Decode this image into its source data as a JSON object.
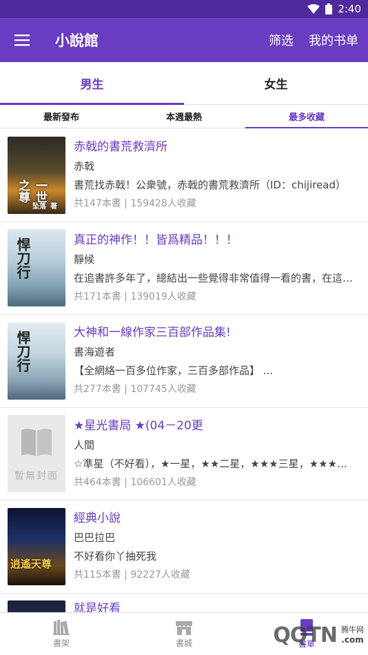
{
  "status_bar": {
    "time": "2:40"
  },
  "app_bar": {
    "title": "小說館",
    "filter_label": "筛选",
    "booklist_label": "我的书单"
  },
  "gender_tabs": [
    {
      "label": "男生",
      "active": true
    },
    {
      "label": "女生",
      "active": false
    }
  ],
  "sort_tabs": [
    {
      "label": "最新發布",
      "active": false
    },
    {
      "label": "本週最熱",
      "active": false
    },
    {
      "label": "最多收藏",
      "active": true
    }
  ],
  "booklists": [
    {
      "title": "赤戟的書荒救濟所",
      "author": "赤戟",
      "desc": "書荒找赤戟！公衆號，赤戟的書荒救濟所（ID：chijiread）",
      "stats": "共147本書 | 159428人收藏",
      "cover_text": "一世之尊",
      "cover_author": "坠落",
      "cover_author_mark": "著"
    },
    {
      "title": "真正的神作！！皆爲精品！！！",
      "author": "靜候",
      "desc": "在追書許多年了，總結出一些覺得非常值得一看的書，在這裏分享給大家",
      "stats": "共171本書 | 139019人收藏",
      "cover_text": "悍刀行"
    },
    {
      "title": "大神和一線作家三百部作品集!",
      "author": "書海遊者",
      "desc": "【全網絡一百多位作家，三百多部作品】 ...",
      "stats": "共277本書 | 107745人收藏",
      "cover_text": "悍刀行"
    },
    {
      "title": "★星光書局 ★(04－20更",
      "author": "人間",
      "desc": "☆準星（不好看），★一星，★★二星，★★★三星，★★★★四星",
      "stats": "共464本書 | 106601人收藏",
      "cover_text": "暫無封面"
    },
    {
      "title": "經典小說",
      "author": "巴巴拉巴",
      "desc": "不好看你丫抽死我",
      "stats": "共115本書 | 92227人收藏",
      "cover_text": "逍遙天尊"
    },
    {
      "title": "就是好看",
      "author": "",
      "desc": "",
      "stats": ""
    }
  ],
  "bottom_nav": [
    {
      "label": "書架",
      "icon": "bookshelf-icon",
      "active": false
    },
    {
      "label": "書城",
      "icon": "store-icon",
      "active": false
    },
    {
      "label": "書單",
      "icon": "booklist-icon",
      "active": true
    }
  ],
  "watermark": {
    "logo": "QQTN",
    "site": "腾牛网",
    "domain": ".com"
  },
  "colors": {
    "primary": "#6a3cc1",
    "status_bar": "#4e2a9c",
    "muted": "#999999"
  }
}
